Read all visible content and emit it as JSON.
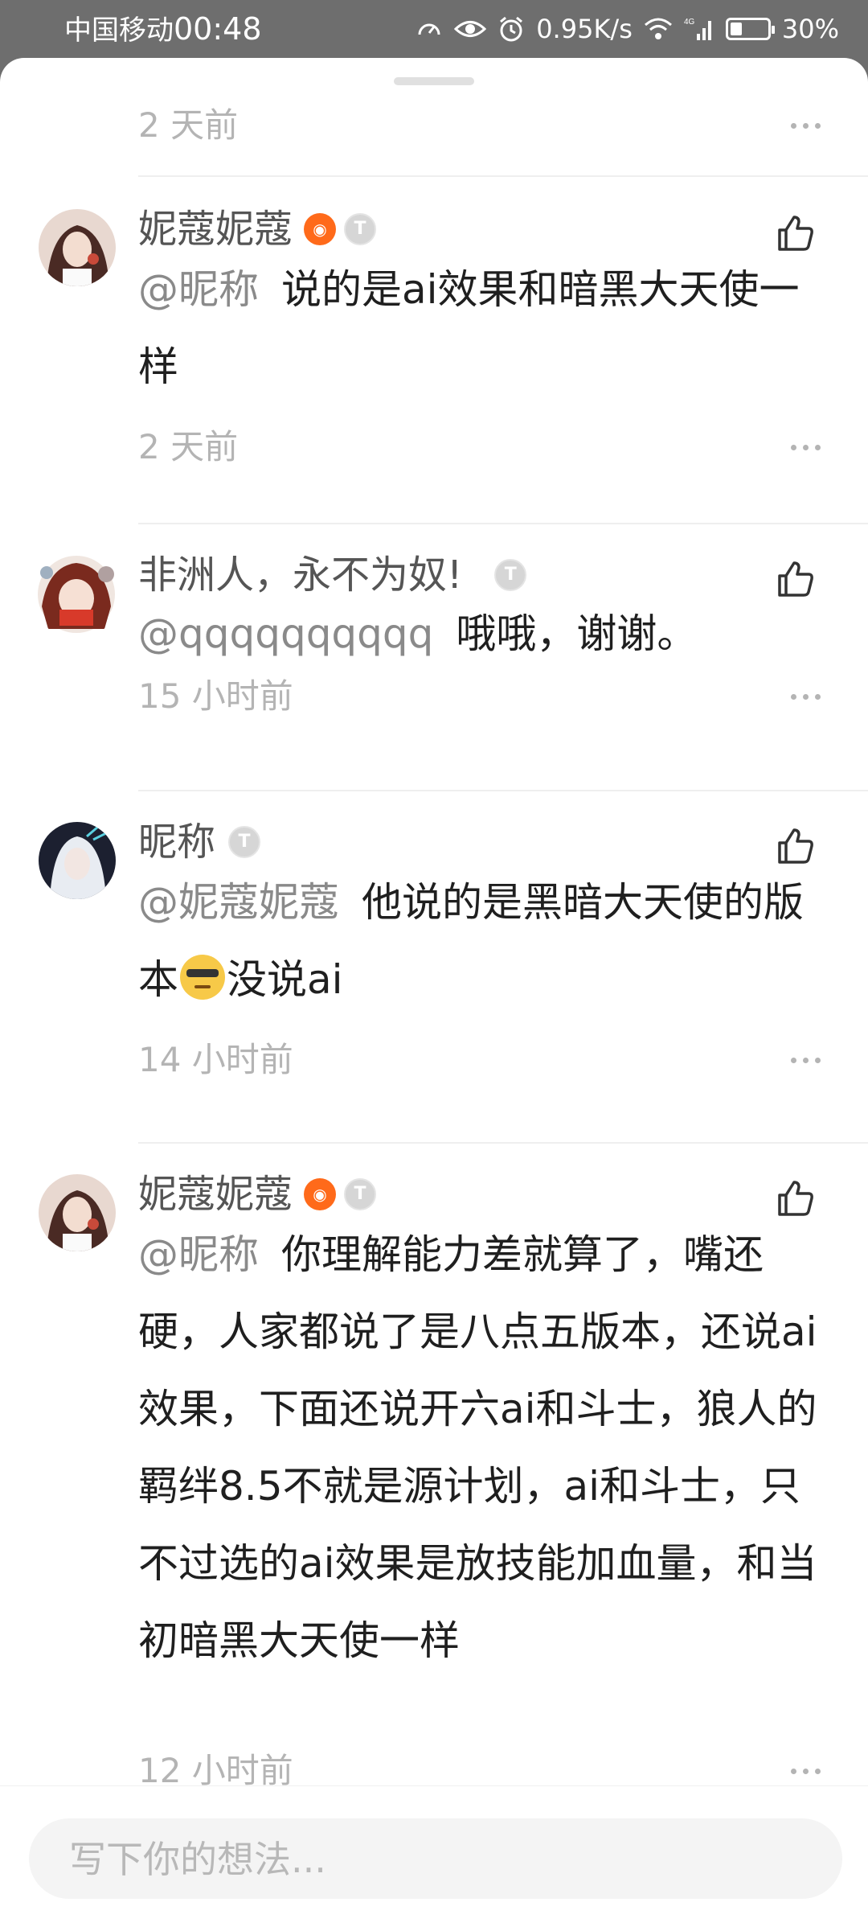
{
  "status_bar": {
    "carrier": "中国移动",
    "time": "00:48",
    "network_speed": "0.95K/s",
    "network_type": "4G",
    "battery": "30%",
    "icons": [
      "speed-icon",
      "eye-icon",
      "alarm-icon",
      "wifi-icon",
      "signal-icon",
      "battery-icon"
    ]
  },
  "top_meta": {
    "time": "2 天前"
  },
  "comments": [
    {
      "user": "妮蔻妮蔻",
      "badges": [
        "orange-badge",
        "t-level-badge"
      ],
      "badge_t": "T",
      "mention": "@昵称",
      "text": "说的是ai效果和暗黑大天使一样",
      "time": "2 天前"
    },
    {
      "user": "非洲人，永不为奴!",
      "badges": [
        "t-level-badge"
      ],
      "badge_t": "T",
      "mention": "@qqqqqqqqqq",
      "text": "哦哦，谢谢。",
      "time": "15 小时前"
    },
    {
      "user": "昵称",
      "badges": [
        "t-level-badge"
      ],
      "badge_t": "T",
      "mention": "@妮蔻妮蔻",
      "text_before_emoji": "他说的是黑暗大天使的版本",
      "emoji": "cool-sweat-emoji",
      "text_after_emoji": "没说ai",
      "time": "14 小时前"
    },
    {
      "user": "妮蔻妮蔻",
      "badges": [
        "orange-badge",
        "t-level-badge"
      ],
      "badge_t": "T",
      "mention": "@昵称",
      "text": "你理解能力差就算了，嘴还硬，人家都说了是八点五版本，还说ai效果，下面还说开六ai和斗士，狼人的羁绊8.5不就是源计划，ai和斗士，只不过选的ai效果是放技能加血量，和当初暗黑大天使一样",
      "time": "12 小时前"
    }
  ],
  "input": {
    "placeholder": "写下你的想法..."
  },
  "colors": {
    "accent_orange": "#ff6a1a",
    "meta_gray": "#b4b4b4",
    "mention_gray": "#8a8a8a"
  }
}
